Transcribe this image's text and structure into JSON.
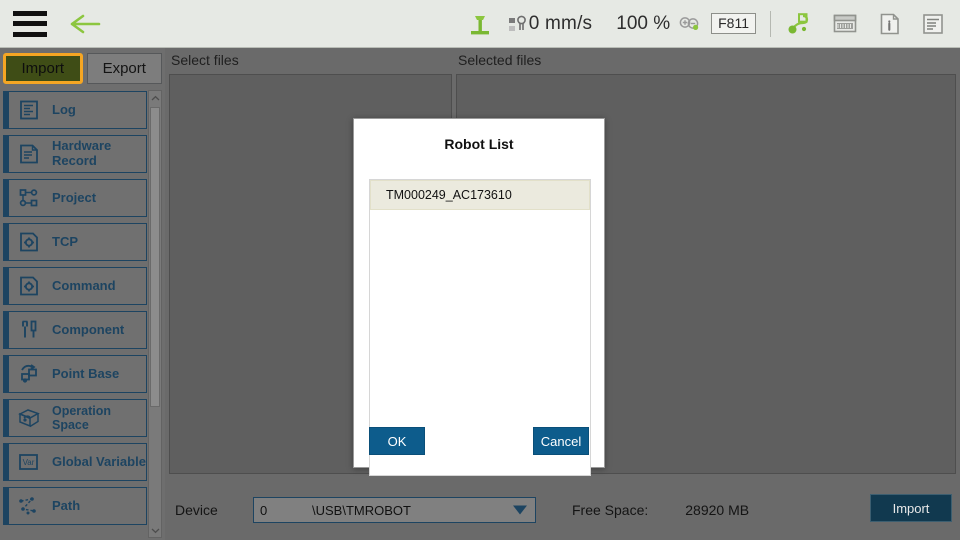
{
  "topbar": {
    "menu_icon": "hamburger-menu-icon",
    "back_icon": "back-arrow-icon",
    "robot_icon": "robot-status-icon",
    "speed_icon": "speed-icon",
    "speed_value": "0 mm/s",
    "percent_value": "100 %",
    "zoom_icon": "zoom-in-out-icon",
    "function_badge": "F811",
    "joint_icon": "joint-settings-icon",
    "keyboard_icon": "keyboard-icon",
    "info_icon": "info-icon",
    "log-icon": "log-list-icon",
    "accent_green": "#8cc63f"
  },
  "sidebar": {
    "tabs": [
      {
        "label": "Import",
        "active": true
      },
      {
        "label": "Export",
        "active": false
      }
    ],
    "items": [
      {
        "label": "Log",
        "icon": "log-document-icon"
      },
      {
        "label": "Hardware Record",
        "icon": "hardware-record-icon"
      },
      {
        "label": "Project",
        "icon": "project-tree-icon"
      },
      {
        "label": "TCP",
        "icon": "tcp-gear-icon"
      },
      {
        "label": "Command",
        "icon": "command-gear-icon"
      },
      {
        "label": "Component",
        "icon": "component-tools-icon"
      },
      {
        "label": "Point Base",
        "icon": "point-base-icon"
      },
      {
        "label": "Operation Space",
        "icon": "operation-space-icon"
      },
      {
        "label": "Global Variable",
        "icon": "global-variable-icon"
      },
      {
        "label": "Path",
        "icon": "path-nodes-icon"
      }
    ],
    "scroll_up_icon": "chevron-up-icon",
    "scroll_down_icon": "chevron-down-icon",
    "accent_blue": "#1d4461",
    "active_tab_bg": "#3f4d16",
    "focus_border": "#f5a623"
  },
  "main": {
    "select_files_header": "Select files",
    "selected_files_header": "Selected files",
    "device_label": "Device",
    "device_index": "0",
    "device_path": "\\USB\\TMROBOT",
    "dropdown_icon": "chevron-down-icon",
    "free_space_label": "Free Space:",
    "free_space_value": "28920 MB",
    "import_button": "Import"
  },
  "modal": {
    "title": "Robot List",
    "items": [
      "TM000249_AC173610"
    ],
    "ok_label": "OK",
    "cancel_label": "Cancel",
    "button_color": "#0d5c8c",
    "selected_row_bg": "#ebeade"
  }
}
